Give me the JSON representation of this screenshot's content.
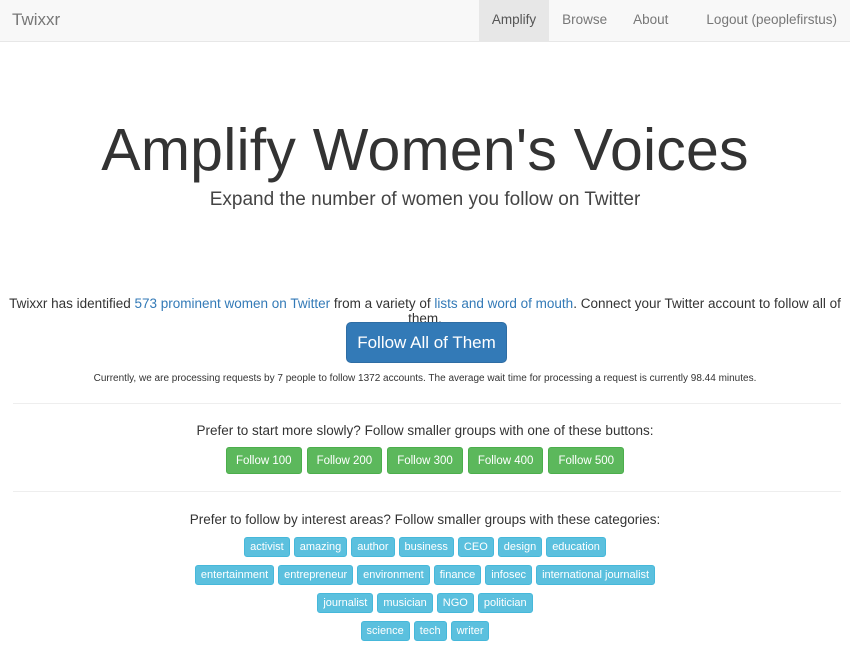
{
  "navbar": {
    "brand": "Twixxr",
    "items": [
      {
        "label": "Amplify",
        "active": true
      },
      {
        "label": "Browse",
        "active": false
      },
      {
        "label": "About",
        "active": false
      },
      {
        "label": "Logout (peoplefirstus)",
        "active": false
      }
    ]
  },
  "hero": {
    "title": "Amplify Women's Voices",
    "subtitle": "Expand the number of women you follow on Twitter"
  },
  "intro": {
    "prefix": "Twixxr has identified ",
    "link1": "573 prominent women on Twitter",
    "middle": " from a variety of ",
    "link2": "lists and word of mouth",
    "suffix": ". Connect your Twitter account to follow all of them."
  },
  "follow_all_button": "Follow All of Them",
  "status_text": "Currently, we are processing requests by 7 people to follow 1372 accounts. The average wait time for processing a request is currently 98.44 minutes.",
  "groups": {
    "label": "Prefer to start more slowly? Follow smaller groups with one of these buttons:",
    "buttons": [
      "Follow 100",
      "Follow 200",
      "Follow 300",
      "Follow 400",
      "Follow 500"
    ]
  },
  "categories": {
    "label": "Prefer to follow by interest areas? Follow smaller groups with these categories:",
    "rows": [
      [
        "activist",
        "amazing",
        "author",
        "business",
        "CEO",
        "design",
        "education"
      ],
      [
        "entertainment",
        "entrepreneur",
        "environment",
        "finance",
        "infosec",
        "international journalist"
      ],
      [
        "journalist",
        "musician",
        "NGO",
        "politician"
      ],
      [
        "science",
        "tech",
        "writer"
      ]
    ]
  },
  "colors": {
    "primary": "#337ab7",
    "success": "#5cb85c",
    "info": "#5bc0de",
    "navbar_bg": "#f8f8f8"
  }
}
